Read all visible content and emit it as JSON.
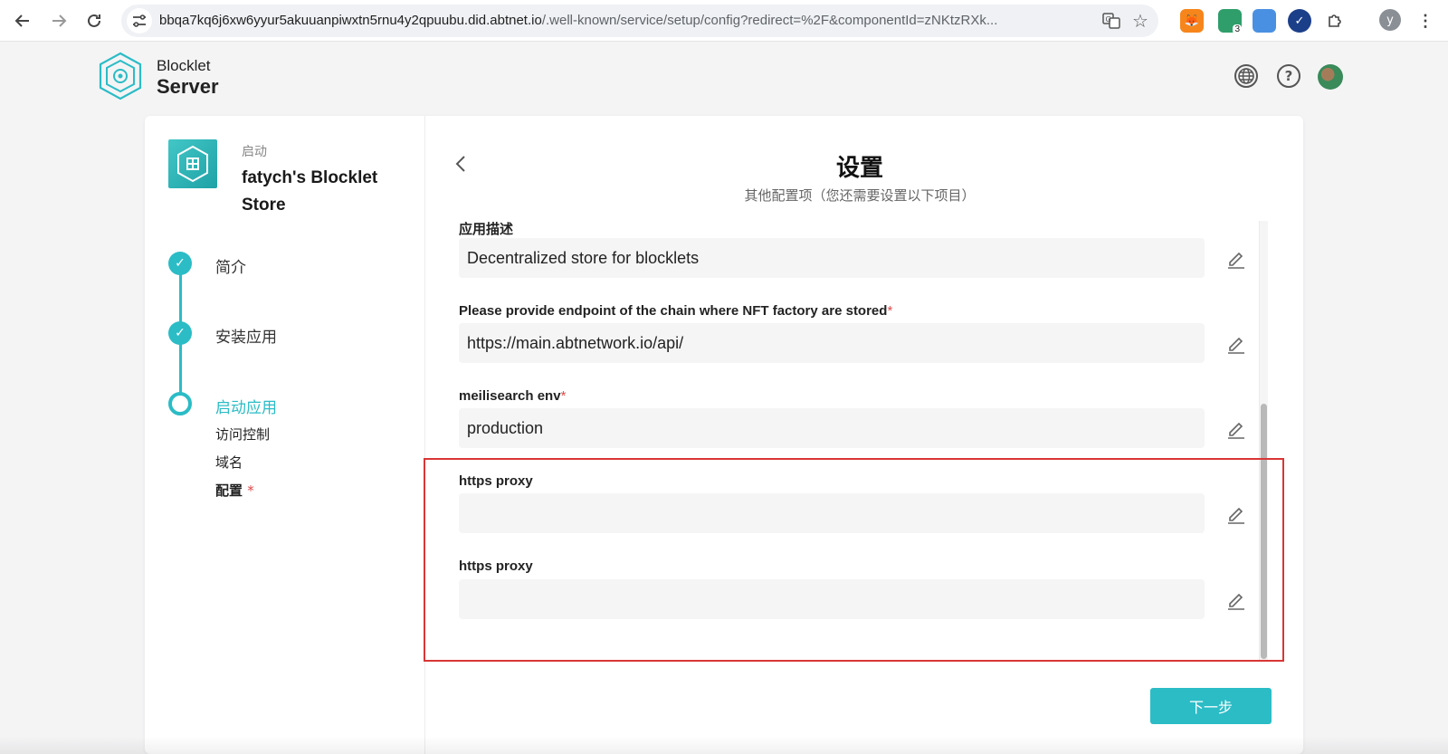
{
  "browser": {
    "url_host": "bbqa7kq6j6xw6yyur5akuuanpiwxtn5rnu4y2qpuubu.did.abtnet.io",
    "url_path": "/.well-known/service/setup/config?redirect=%2F&componentId=zNKtzRXk...",
    "profile_initial": "y",
    "extension_badge": "3",
    "icons": [
      "back-arrow-icon",
      "forward-arrow-icon",
      "reload-icon",
      "site-settings-icon",
      "translate-icon",
      "bookmark-star-icon",
      "metamask-icon",
      "extension-icon",
      "extension-icon",
      "extension-icon",
      "puzzle-icon",
      "menu-dots-icon"
    ]
  },
  "header": {
    "brand_line1": "Blocklet",
    "brand_line2": "Server"
  },
  "sidebar": {
    "subtitle": "启动",
    "app_title": "fatych's Blocklet Store",
    "steps": [
      {
        "label": "简介",
        "status": "done"
      },
      {
        "label": "安装应用",
        "status": "done"
      },
      {
        "label": "启动应用",
        "status": "current"
      }
    ],
    "sub_steps": [
      {
        "label": "访问控制"
      },
      {
        "label": "域名"
      },
      {
        "label": "配置",
        "required_mark": "*"
      }
    ]
  },
  "main": {
    "title": "设置",
    "subtitle": "其他配置项（您还需要设置以下项目）",
    "fields": [
      {
        "label": "应用描述",
        "value": "Decentralized store for blocklets",
        "required_mark": ""
      },
      {
        "label": "Please provide endpoint of the chain where NFT factory are stored",
        "value": "https://main.abtnetwork.io/api/",
        "required_mark": "*"
      },
      {
        "label": "meilisearch env",
        "value": "production",
        "required_mark": "*"
      },
      {
        "label": "https proxy",
        "value": "",
        "required_mark": ""
      },
      {
        "label": "https proxy",
        "value": "",
        "required_mark": ""
      }
    ],
    "next_label": "下一步"
  },
  "colors": {
    "accent": "#2bbcc6",
    "highlight": "#d93636",
    "required": "#e04848"
  }
}
